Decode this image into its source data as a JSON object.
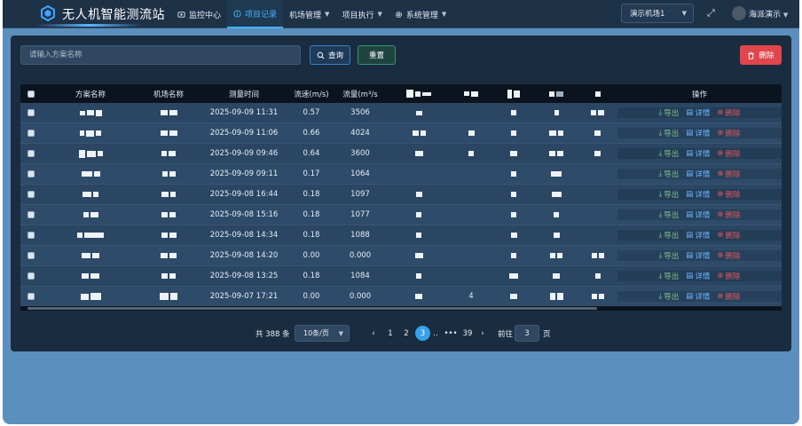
{
  "header": {
    "app_title": "无人机智能测流站",
    "nav": [
      {
        "label": "监控中心",
        "icon": "monitor-icon",
        "active": false,
        "has_menu": false
      },
      {
        "label": "项目记录",
        "icon": "info-icon",
        "active": true,
        "has_menu": false
      },
      {
        "label": "机场管理",
        "icon": "",
        "active": false,
        "has_menu": true
      },
      {
        "label": "项目执行",
        "icon": "",
        "active": false,
        "has_menu": true
      },
      {
        "label": "系统管理",
        "icon": "gear-icon",
        "active": false,
        "has_menu": true
      }
    ],
    "airport_select": "演示机场1",
    "user_name": "海派演示"
  },
  "toolbar": {
    "search_placeholder": "请输入方案名称",
    "search_value": "",
    "query_label": "查询",
    "reset_label": "重置",
    "delete_label": "删除"
  },
  "table": {
    "columns": {
      "name": "方案名称",
      "airport": "机场名称",
      "time": "测量时间",
      "speed": "流速(m/s)",
      "flow": "流量(m³/s",
      "ops": "操作"
    },
    "actions": {
      "export": "导出",
      "detail": "详情",
      "delete": "删除"
    },
    "rows": [
      {
        "time": "2025-09-09 11:31",
        "speed": "0.57",
        "flow": "3506",
        "extra": ""
      },
      {
        "time": "2025-09-09 11:06",
        "speed": "0.66",
        "flow": "4024",
        "extra": ""
      },
      {
        "time": "2025-09-09 09:46",
        "speed": "0.64",
        "flow": "3600",
        "extra": ""
      },
      {
        "time": "2025-09-09 09:11",
        "speed": "0.17",
        "flow": "1064",
        "extra": ""
      },
      {
        "time": "2025-09-08 16:44",
        "speed": "0.18",
        "flow": "1097",
        "extra": ""
      },
      {
        "time": "2025-09-08 15:16",
        "speed": "0.18",
        "flow": "1077",
        "extra": ""
      },
      {
        "time": "2025-09-08 14:34",
        "speed": "0.18",
        "flow": "1088",
        "extra": ""
      },
      {
        "time": "2025-09-08 14:20",
        "speed": "0.00",
        "flow": "0.000",
        "extra": ""
      },
      {
        "time": "2025-09-08 13:25",
        "speed": "0.18",
        "flow": "1084",
        "extra": ""
      },
      {
        "time": "2025-09-07 17:21",
        "speed": "0.00",
        "flow": "0.000",
        "extra": "4"
      }
    ]
  },
  "pagination": {
    "total_text": "共 388 条",
    "page_size": "10条/页",
    "pages": [
      "1",
      "2",
      "3",
      "..",
      "•••",
      "39"
    ],
    "current_page": "3",
    "goto_label": "前往",
    "goto_value": "3",
    "page_unit": "页"
  },
  "colors": {
    "accent": "#35a2e8",
    "header_bg": "#1d3147",
    "panel_bg": "#1a2c40",
    "page_bg": "#5b8fbd",
    "danger": "#e0464c",
    "export_green": "#7cc08a",
    "detail_blue": "#6db7ff"
  }
}
